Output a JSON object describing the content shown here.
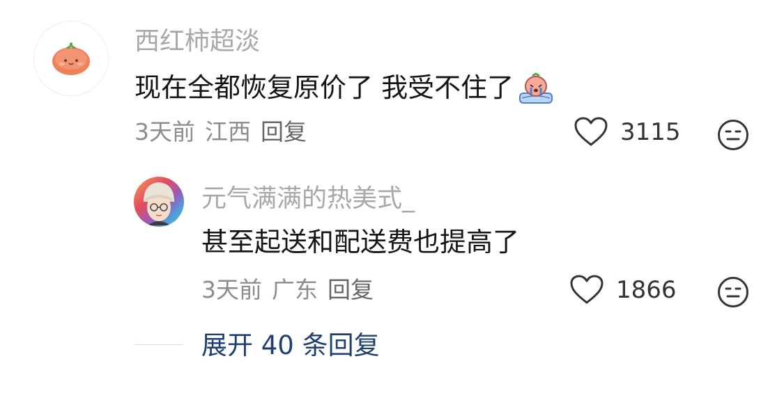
{
  "main_comment": {
    "username": "西红柿超淡",
    "text": "现在全都恢复原价了 我受不住了",
    "emoji_icon": "crying-peach-emoji-icon",
    "time": "3天前",
    "location": "江西",
    "reply_label": "回复",
    "like_count": "3115"
  },
  "reply_comment": {
    "username": "元气满满的热美式_",
    "text": "甚至起送和配送费也提高了",
    "time": "3天前",
    "location": "广东",
    "reply_label": "回复",
    "like_count": "1866"
  },
  "expand": {
    "label": "展开 40 条回复"
  },
  "colors": {
    "username": "#a8a8a8",
    "meta": "#8c8c8c",
    "link": "#1f3f73"
  }
}
